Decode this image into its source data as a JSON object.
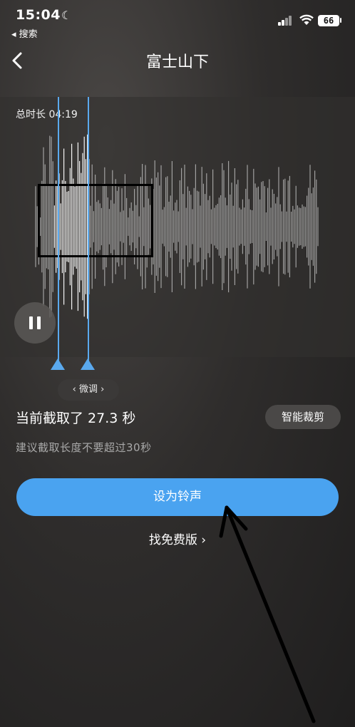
{
  "status_bar": {
    "time": "15:04",
    "back_app": "◂ 搜索",
    "battery": "66"
  },
  "nav": {
    "back_glyph": "‹",
    "title": "富士山下"
  },
  "editor": {
    "total_duration": "总时长 04:19",
    "finetune_label": "‹ 微调 ›",
    "current_selection": "当前截取了 27.3 秒",
    "smart_cut_label": "智能裁剪",
    "suggestion": "建议截取长度不要超过30秒"
  },
  "actions": {
    "set_ringtone": "设为铃声",
    "find_free": "找免费版 ›"
  },
  "colors": {
    "accent": "#4aa3f0",
    "marker": "#5aa9ee"
  }
}
